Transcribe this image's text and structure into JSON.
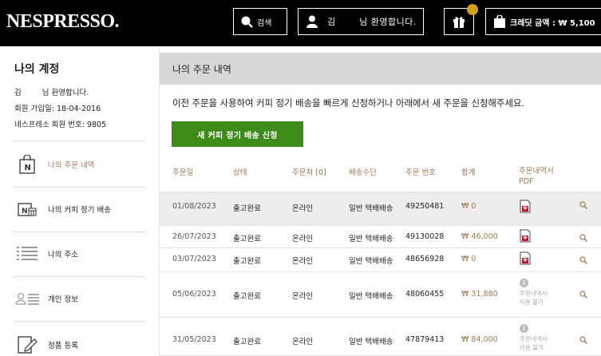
{
  "header": {
    "logo": "NESPRESSO.",
    "search_label": "검색",
    "user_initial": "김",
    "user_greeting": "님 환영합니다.",
    "cart_label": "크레딧 금액 : ₩ 5,100"
  },
  "sidebar": {
    "title": "나의 계정",
    "name_initial": "김",
    "name_greeting": "님 환영합니다.",
    "join_date": "회원 가입일: 18-04-2016",
    "member_no": "네스프레소 회원 번호: 9805",
    "items": [
      {
        "label": "나의 주문 내역",
        "icon": "shopping-bag-icon"
      },
      {
        "label": "나의 커피 정기 배송",
        "icon": "coffee-subscription-icon"
      },
      {
        "label": "나의 주소",
        "icon": "address-list-icon"
      },
      {
        "label": "개인 정보",
        "icon": "personal-info-icon"
      },
      {
        "label": "정품 등록",
        "icon": "product-registration-icon"
      }
    ]
  },
  "main": {
    "title": "나의 주문 내역",
    "intro": "이전 주문을 사용하여 커피 정기 배송을 빠르게 신청하거나 아래에서 새 주문을 신청해주세요.",
    "cta_label": "새 커피 정기 배송 신청"
  },
  "table": {
    "headers": [
      "주문일",
      "상태",
      "주문처 [0]",
      "배송수단",
      "주문 번호",
      "합계",
      "주문내역서",
      "PDF"
    ],
    "rows": [
      {
        "date": "01/08/2023",
        "status": "출고완료",
        "channel": "온라인",
        "delivery": "일반 택배배송",
        "order_no": "49250481",
        "total": "₩ 0",
        "invoice": "pdf",
        "na1": "",
        "na2": ""
      },
      {
        "date": "26/07/2023",
        "status": "출고완료",
        "channel": "온라인",
        "delivery": "일반 택배배송",
        "order_no": "49130028",
        "total": "₩ 46,000",
        "invoice": "pdf",
        "na1": "",
        "na2": ""
      },
      {
        "date": "03/07/2023",
        "status": "출고완료",
        "channel": "온라인",
        "delivery": "일반 택배배송",
        "order_no": "48656928",
        "total": "₩ 0",
        "invoice": "pdf",
        "na1": "",
        "na2": ""
      },
      {
        "date": "05/06/2023",
        "status": "출고완료",
        "channel": "온라인",
        "delivery": "일반 택배배송",
        "order_no": "48060455",
        "total": "₩ 31,880",
        "invoice": "na",
        "na1": "주문내역서",
        "na2": "이용 불가"
      },
      {
        "date": "31/05/2023",
        "status": "출고완료",
        "channel": "온라인",
        "delivery": "일반 택배배송",
        "order_no": "47879413",
        "total": "₩ 84,000",
        "invoice": "na",
        "na1": "주문내역서",
        "na2": "이용 불가"
      }
    ]
  },
  "colors": {
    "header_bg": "#000000",
    "accent_gold": "#9b7b52",
    "cta_green": "#3e8b1a",
    "badge": "#d4a017",
    "pdf_red": "#c8102e"
  }
}
